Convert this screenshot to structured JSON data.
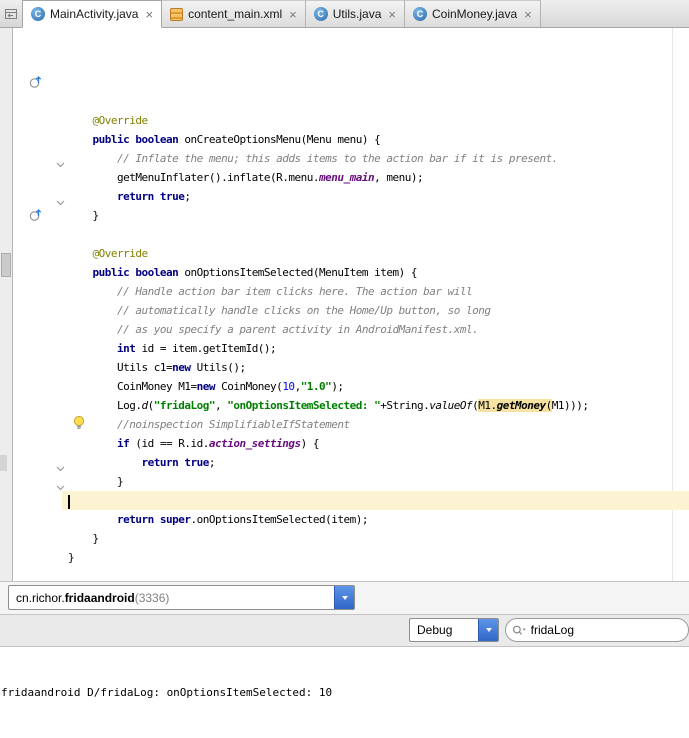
{
  "tabs": {
    "close_glyph": "×",
    "items": [
      {
        "label": "MainActivity.java",
        "icon": "java-class-icon",
        "active": true
      },
      {
        "label": "content_main.xml",
        "icon": "xml-file-icon",
        "active": false
      },
      {
        "label": "Utils.java",
        "icon": "java-class-icon",
        "active": false
      },
      {
        "label": "CoinMoney.java",
        "icon": "java-class-icon",
        "active": false
      }
    ]
  },
  "editor": {
    "caret_line": 20,
    "gutter_marks": [
      {
        "line": 1,
        "type": "override-icon"
      },
      {
        "line": 5,
        "type": "fold-icon"
      },
      {
        "line": 7,
        "type": "fold-icon"
      },
      {
        "line": 8,
        "type": "override-icon"
      },
      {
        "line": 19,
        "type": "lightbulb-icon"
      },
      {
        "line": 21,
        "type": "fold-icon"
      },
      {
        "line": 22,
        "type": "fold-icon"
      }
    ],
    "lines": [
      {
        "segs": [
          {
            "t": "    @Override",
            "s": "ann"
          }
        ]
      },
      {
        "segs": [
          {
            "t": "    ",
            "s": "p"
          },
          {
            "t": "public boolean",
            "s": "kw"
          },
          {
            "t": " onCreateOptionsMenu(Menu menu) {",
            "s": "p"
          }
        ]
      },
      {
        "segs": [
          {
            "t": "        ",
            "s": "p"
          },
          {
            "t": "// Inflate the menu; this adds items to the action bar if it is present.",
            "s": "cm"
          }
        ]
      },
      {
        "segs": [
          {
            "t": "        getMenuInflater().inflate(R.menu.",
            "s": "p"
          },
          {
            "t": "menu_main",
            "s": "fld"
          },
          {
            "t": ", menu);",
            "s": "p"
          }
        ]
      },
      {
        "segs": [
          {
            "t": "        ",
            "s": "p"
          },
          {
            "t": "return true",
            "s": "kw"
          },
          {
            "t": ";",
            "s": "p"
          }
        ]
      },
      {
        "segs": [
          {
            "t": "    }",
            "s": "p"
          }
        ]
      },
      {
        "segs": []
      },
      {
        "segs": [
          {
            "t": "    @Override",
            "s": "ann"
          }
        ]
      },
      {
        "segs": [
          {
            "t": "    ",
            "s": "p"
          },
          {
            "t": "public boolean",
            "s": "kw"
          },
          {
            "t": " onOptionsItemSelected(MenuItem item) {",
            "s": "p"
          }
        ]
      },
      {
        "segs": [
          {
            "t": "        ",
            "s": "p"
          },
          {
            "t": "// Handle action bar item clicks here. The action bar will",
            "s": "cm"
          }
        ]
      },
      {
        "segs": [
          {
            "t": "        ",
            "s": "p"
          },
          {
            "t": "// automatically handle clicks on the Home/Up button, so long",
            "s": "cm"
          }
        ]
      },
      {
        "segs": [
          {
            "t": "        ",
            "s": "p"
          },
          {
            "t": "// as you specify a parent activity in AndroidManifest.xml.",
            "s": "cm"
          }
        ]
      },
      {
        "segs": [
          {
            "t": "        ",
            "s": "p"
          },
          {
            "t": "int",
            "s": "kw"
          },
          {
            "t": " id = item.getItemId();",
            "s": "p"
          }
        ]
      },
      {
        "segs": [
          {
            "t": "        Utils c1=",
            "s": "p"
          },
          {
            "t": "new",
            "s": "kw"
          },
          {
            "t": " Utils();",
            "s": "p"
          }
        ]
      },
      {
        "segs": [
          {
            "t": "        CoinMoney M1=",
            "s": "p"
          },
          {
            "t": "new",
            "s": "kw"
          },
          {
            "t": " CoinMoney(",
            "s": "p"
          },
          {
            "t": "10",
            "s": "num"
          },
          {
            "t": ",",
            "s": "p"
          },
          {
            "t": "\"1.0\"",
            "s": "str"
          },
          {
            "t": ");",
            "s": "p"
          }
        ]
      },
      {
        "segs": [
          {
            "t": "        Log.",
            "s": "p"
          },
          {
            "t": "d",
            "s": "sm"
          },
          {
            "t": "(",
            "s": "p"
          },
          {
            "t": "\"fridaLog\"",
            "s": "str"
          },
          {
            "t": ", ",
            "s": "p"
          },
          {
            "t": "\"onOptionsItemSelected: \"",
            "s": "str"
          },
          {
            "t": "+String.",
            "s": "p"
          },
          {
            "t": "valueOf",
            "s": "sm"
          },
          {
            "t": "(",
            "s": "p"
          },
          {
            "t": "M1.",
            "s": "hl"
          },
          {
            "t": "getMoney",
            "s": "hlm"
          },
          {
            "t": "(",
            "s": "hl"
          },
          {
            "t": "M1)));",
            "s": "p"
          }
        ]
      },
      {
        "segs": [
          {
            "t": "        ",
            "s": "p"
          },
          {
            "t": "//noinspection SimplifiableIfStatement",
            "s": "cm"
          }
        ]
      },
      {
        "segs": [
          {
            "t": "        ",
            "s": "p"
          },
          {
            "t": "if",
            "s": "kw"
          },
          {
            "t": " (id == R.id.",
            "s": "p"
          },
          {
            "t": "action_settings",
            "s": "fld"
          },
          {
            "t": ") {",
            "s": "p"
          }
        ]
      },
      {
        "segs": [
          {
            "t": "            ",
            "s": "p"
          },
          {
            "t": "return true",
            "s": "kw"
          },
          {
            "t": ";",
            "s": "p"
          }
        ]
      },
      {
        "segs": [
          {
            "t": "        }",
            "s": "p"
          }
        ]
      },
      {
        "segs": []
      },
      {
        "segs": [
          {
            "t": "        ",
            "s": "p"
          },
          {
            "t": "return super",
            "s": "kw"
          },
          {
            "t": ".onOptionsItemSelected(item);",
            "s": "p"
          }
        ]
      },
      {
        "segs": [
          {
            "t": "    }",
            "s": "p"
          }
        ]
      },
      {
        "segs": [
          {
            "t": "}",
            "s": "p"
          }
        ]
      }
    ]
  },
  "logcat": {
    "process": {
      "prefix": "cn.richor.",
      "bold": "fridaandroid",
      "suffix": " (3336)"
    },
    "level": "Debug",
    "search_value": "fridaLog",
    "output": "fridaandroid D/fridaLog: onOptionsItemSelected: 10"
  },
  "colors": {
    "keyword": "#000080",
    "string": "#008000",
    "comment": "#808080",
    "number": "#0000FF",
    "constant": "#660E7A",
    "annotation": "#808000",
    "usage_highlight": "#F6E3A2",
    "caret_row": "#FCF3D3",
    "combo_button_blue": "#3D77D8"
  }
}
